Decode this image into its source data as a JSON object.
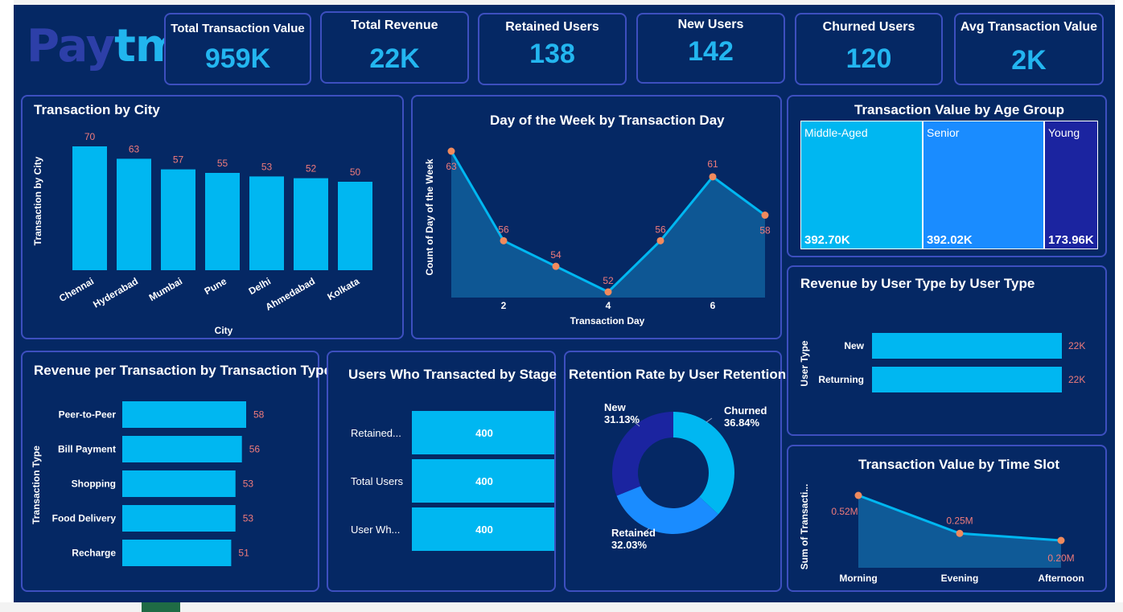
{
  "logo": {
    "part1": "Pay",
    "part2": "tm"
  },
  "kpis": [
    {
      "title": "Total Transaction Value",
      "value": "959K"
    },
    {
      "title": "Total Revenue",
      "value": "22K"
    },
    {
      "title": "Retained Users",
      "value": "138"
    },
    {
      "title": "New Users",
      "value": "142"
    },
    {
      "title": "Churned Users",
      "value": "120"
    },
    {
      "title": "Avg Transaction Value",
      "value": "2K"
    }
  ],
  "titles": {
    "city": "Transaction by City",
    "dow": "Day of the Week by Transaction Day",
    "age": "Transaction Value by Age Group",
    "rev_type": "Revenue per Transaction by Transaction Type",
    "stage": "Users Who Transacted by Stage",
    "retention": "Retention Rate by User Retention",
    "user_type": "Revenue by User Type by User Type",
    "time_slot": "Transaction Value by Time Slot"
  },
  "colors": {
    "bar": "#00b7f1",
    "area": "#0f5a97",
    "label": "#f07b7b",
    "point": "#f08a5d",
    "border": "#3d4fbf",
    "bg": "#052864"
  },
  "chart_data": [
    {
      "type": "bar",
      "title": "Transaction by City",
      "xlabel": "City",
      "ylabel": "Transaction by City",
      "categories": [
        "Chennai",
        "Hyderabad",
        "Mumbai",
        "Pune",
        "Delhi",
        "Ahmedabad",
        "Kolkata"
      ],
      "values": [
        70,
        63,
        57,
        55,
        53,
        52,
        50
      ],
      "ylim": [
        0,
        70
      ],
      "grid": false
    },
    {
      "type": "area",
      "title": "Day of the Week by Transaction Day",
      "xlabel": "Transaction Day",
      "ylabel": "Count of Day of the Week",
      "x": [
        1,
        2,
        3,
        4,
        5,
        6,
        7
      ],
      "values": [
        63,
        56,
        54,
        52,
        56,
        61,
        58
      ],
      "xticks": [
        "2",
        "4",
        "6"
      ],
      "ylim": [
        52,
        63
      ]
    },
    {
      "type": "treemap",
      "title": "Transaction Value by Age Group",
      "categories": [
        "Middle-Aged",
        "Senior",
        "Young"
      ],
      "values": [
        392.7,
        392.02,
        173.96
      ],
      "value_labels": [
        "392.70K",
        "392.02K",
        "173.96K"
      ],
      "colors": [
        "#00b7f1",
        "#1a8cff",
        "#1b24a0"
      ]
    },
    {
      "type": "bar",
      "orientation": "horizontal",
      "title": "Revenue per Transaction by Transaction Type",
      "ylabel": "Transaction Type",
      "categories": [
        "Peer-to-Peer",
        "Bill Payment",
        "Shopping",
        "Food Delivery",
        "Recharge"
      ],
      "values": [
        58,
        56,
        53,
        53,
        51
      ]
    },
    {
      "type": "funnel",
      "title": "Users Who Transacted by Stage",
      "categories": [
        "Retained...",
        "Total Users",
        "User Wh..."
      ],
      "values": [
        400,
        400,
        400
      ]
    },
    {
      "type": "pie",
      "title": "Retention Rate by User Retention",
      "categories": [
        "Churned",
        "Retained",
        "New"
      ],
      "values": [
        36.84,
        32.03,
        31.13
      ],
      "value_labels": [
        "36.84%",
        "32.03%",
        "31.13%"
      ],
      "colors": [
        "#00b7f1",
        "#1a8cff",
        "#1b24a0"
      ]
    },
    {
      "type": "bar",
      "orientation": "horizontal",
      "title": "Revenue by User Type by User Type",
      "ylabel": "User Type",
      "categories": [
        "New",
        "Returning"
      ],
      "values": [
        22,
        22
      ],
      "value_labels": [
        "22K",
        "22K"
      ]
    },
    {
      "type": "area",
      "title": "Transaction Value by Time Slot",
      "ylabel": "Sum of Transacti...",
      "categories": [
        "Morning",
        "Evening",
        "Afternoon"
      ],
      "values": [
        0.52,
        0.25,
        0.2
      ],
      "value_labels": [
        "0.52M",
        "0.25M",
        "0.20M"
      ]
    }
  ]
}
